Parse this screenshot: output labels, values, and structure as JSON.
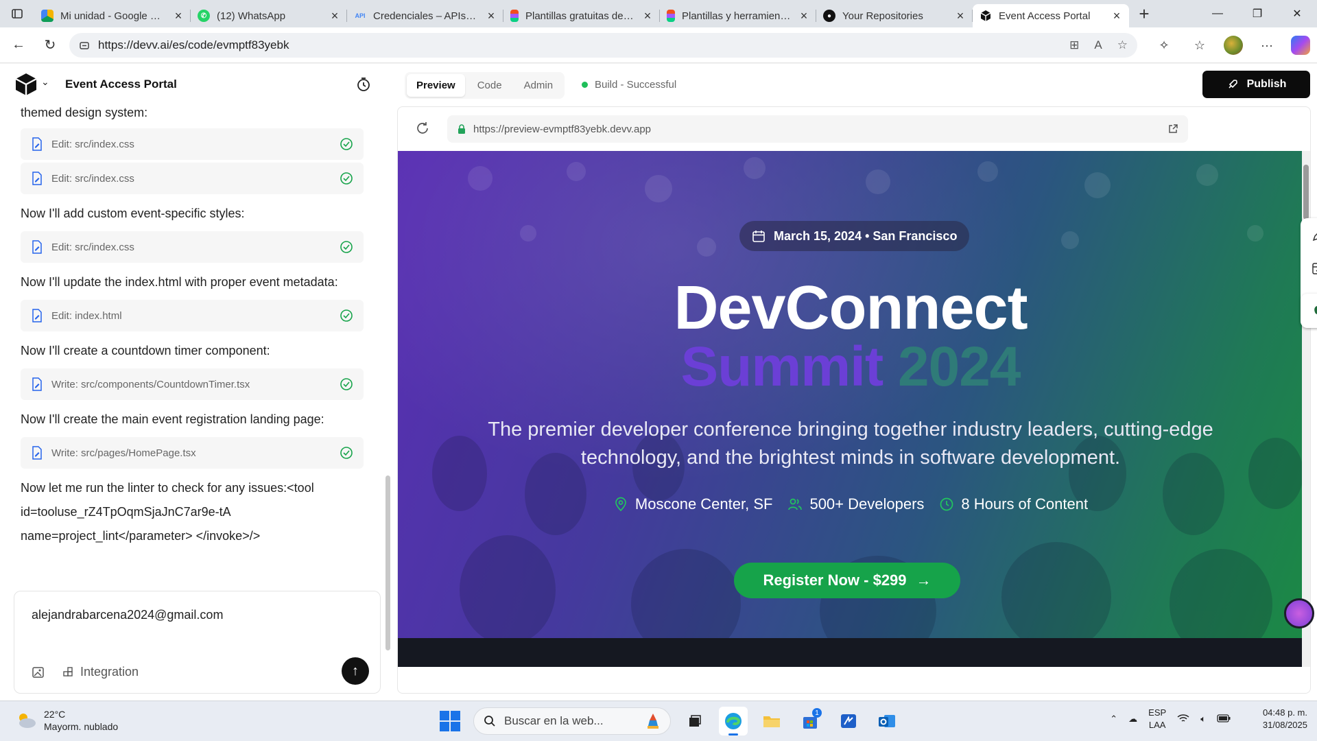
{
  "browser": {
    "tabs": [
      {
        "title": "Mi unidad - Google Drive",
        "icon": "google-drive-icon",
        "color": "#f4b400"
      },
      {
        "title": "(12) WhatsApp",
        "icon": "whatsapp-icon",
        "color": "#25d366"
      },
      {
        "title": "Credenciales – APIs y servicios",
        "icon": "api-icon",
        "color": "#4285f4"
      },
      {
        "title": "Plantillas gratuitas de diseño",
        "icon": "figma-icon",
        "color": "#f24e1e"
      },
      {
        "title": "Plantillas y herramientas",
        "icon": "figma-icon",
        "color": "#a259ff"
      },
      {
        "title": "Your Repositories",
        "icon": "github-icon",
        "color": "#111111"
      },
      {
        "title": "Event Access Portal",
        "icon": "devv-icon",
        "color": "#111111"
      }
    ],
    "url": "https://devv.ai/es/code/evmptf83yebk"
  },
  "app": {
    "project_name": "Event Access Portal",
    "view_tabs": [
      "Preview",
      "Code",
      "Admin"
    ],
    "active_tab": "Preview",
    "build_status": "Build - Successful",
    "publish_label": "Publish"
  },
  "chat": {
    "top_line": "themed design system:",
    "msg_styles": "Now I'll add custom event-specific styles:",
    "msg_index": "Now I'll update the index.html with proper event metadata:",
    "msg_countdown": "Now I'll create a countdown timer component:",
    "msg_landing": "Now I'll create the main event registration landing page:",
    "msg_lint_1": "Now let me run the linter to check for any issues:<tool",
    "msg_lint_2": "id=tooluse_rZ4TpOqmSjaJnC7ar9e-tA",
    "msg_lint_3": "name=project_lint</parameter> </invoke>/>",
    "tool_calls": [
      "Edit: src/index.css",
      "Edit: src/index.css",
      "Edit: src/index.css",
      "Edit: index.html",
      "Write: src/components/CountdownTimer.tsx",
      "Write: src/pages/HomePage.tsx"
    ],
    "composer_text": "alejandrabarcena2024@gmail.com",
    "integration_label": "Integration"
  },
  "preview": {
    "url": "https://preview-evmptf83yebk.devv.app",
    "date_pill": "March 15, 2024 • San Francisco",
    "title_line1": "DevConnect",
    "title_word1": "Summit",
    "title_word2": "2024",
    "subtitle": "The premier developer conference bringing together industry leaders, cutting-edge technology, and the brightest minds in software development.",
    "facts": [
      "Moscone Center, SF",
      "500+ Developers",
      "8 Hours of Content"
    ],
    "register_label": "Register Now - $299"
  },
  "taskbar": {
    "temperature": "22°C",
    "weather": "Mayorm. nublado",
    "search_placeholder": "Buscar en la web...",
    "lang_1": "ESP",
    "lang_2": "LAA",
    "time": "04:48 p. m.",
    "date": "31/08/2025",
    "store_badge": "1"
  }
}
